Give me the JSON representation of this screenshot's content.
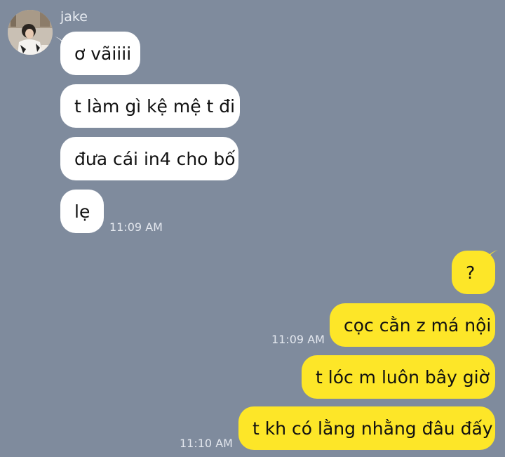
{
  "contact": {
    "name": "jake"
  },
  "messages": [
    {
      "side": "incoming",
      "text": "ơ vãiiii"
    },
    {
      "side": "incoming",
      "text": "t làm gì kệ mệ t đi"
    },
    {
      "side": "incoming",
      "text": "đưa cái in4 cho bố"
    },
    {
      "side": "incoming",
      "text": "lẹ",
      "time": "11:09 AM"
    },
    {
      "side": "outgoing",
      "text": "?"
    },
    {
      "side": "outgoing",
      "text": "cọc cằn z má nội",
      "time": "11:09 AM"
    },
    {
      "side": "outgoing",
      "text": "t lóc m luôn bây giờ"
    },
    {
      "side": "outgoing",
      "text": "t kh có lằng nhằng đâu đấy",
      "time": "11:10 AM"
    }
  ],
  "colors": {
    "background": "#7f8b9d",
    "incoming_bubble": "#ffffff",
    "outgoing_bubble": "#fde628"
  }
}
